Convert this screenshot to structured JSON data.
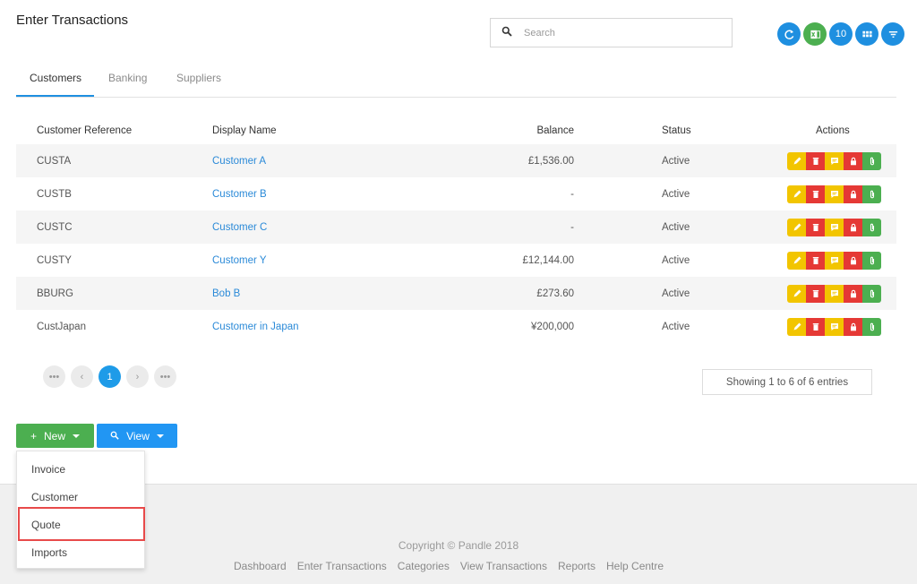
{
  "header": {
    "title": "Enter Transactions",
    "search_placeholder": "Search",
    "icons": [
      "refresh-icon",
      "excel-icon",
      "page-size-10",
      "grid-icon",
      "filter-icon"
    ],
    "page_size_label": "10"
  },
  "tabs": [
    {
      "label": "Customers",
      "active": true
    },
    {
      "label": "Banking",
      "active": false
    },
    {
      "label": "Suppliers",
      "active": false
    }
  ],
  "table": {
    "columns": [
      "Customer Reference",
      "Display Name",
      "Balance",
      "Status",
      "Actions"
    ],
    "rows": [
      {
        "ref": "CUSTA",
        "name": "Customer A",
        "balance": "£1,536.00",
        "status": "Active"
      },
      {
        "ref": "CUSTB",
        "name": "Customer B",
        "balance": "-",
        "status": "Active"
      },
      {
        "ref": "CUSTC",
        "name": "Customer C",
        "balance": "-",
        "status": "Active"
      },
      {
        "ref": "CUSTY",
        "name": "Customer Y",
        "balance": "£12,144.00",
        "status": "Active"
      },
      {
        "ref": "BBURG",
        "name": "Bob B",
        "balance": "£273.60",
        "status": "Active"
      },
      {
        "ref": "CustJapan",
        "name": "Customer in Japan",
        "balance": "¥200,000",
        "status": "Active"
      }
    ],
    "action_icons": [
      "pencil-icon",
      "trash-icon",
      "note-icon",
      "lock-icon",
      "paperclip-icon"
    ]
  },
  "pagination": {
    "first": "•••",
    "prev": "‹",
    "current": "1",
    "next": "›",
    "last": "•••",
    "showing": "Showing 1 to 6 of 6 entries"
  },
  "buttons": {
    "new_label": "New",
    "new_icon": "+",
    "view_label": "View"
  },
  "dropdown": {
    "items": [
      "Invoice",
      "Customer",
      "Quote",
      "Imports"
    ],
    "highlighted": "Quote"
  },
  "footer": {
    "copyright": "Copyright © Pandle 2018",
    "links": [
      "Dashboard",
      "Enter Transactions",
      "Categories",
      "View Transactions",
      "Reports",
      "Help Centre"
    ]
  },
  "colors": {
    "accent_blue": "#1e8fe0",
    "green": "#4caf50",
    "yellow": "#f2c500",
    "red": "#e53935",
    "highlight_red": "#e84a4a"
  }
}
